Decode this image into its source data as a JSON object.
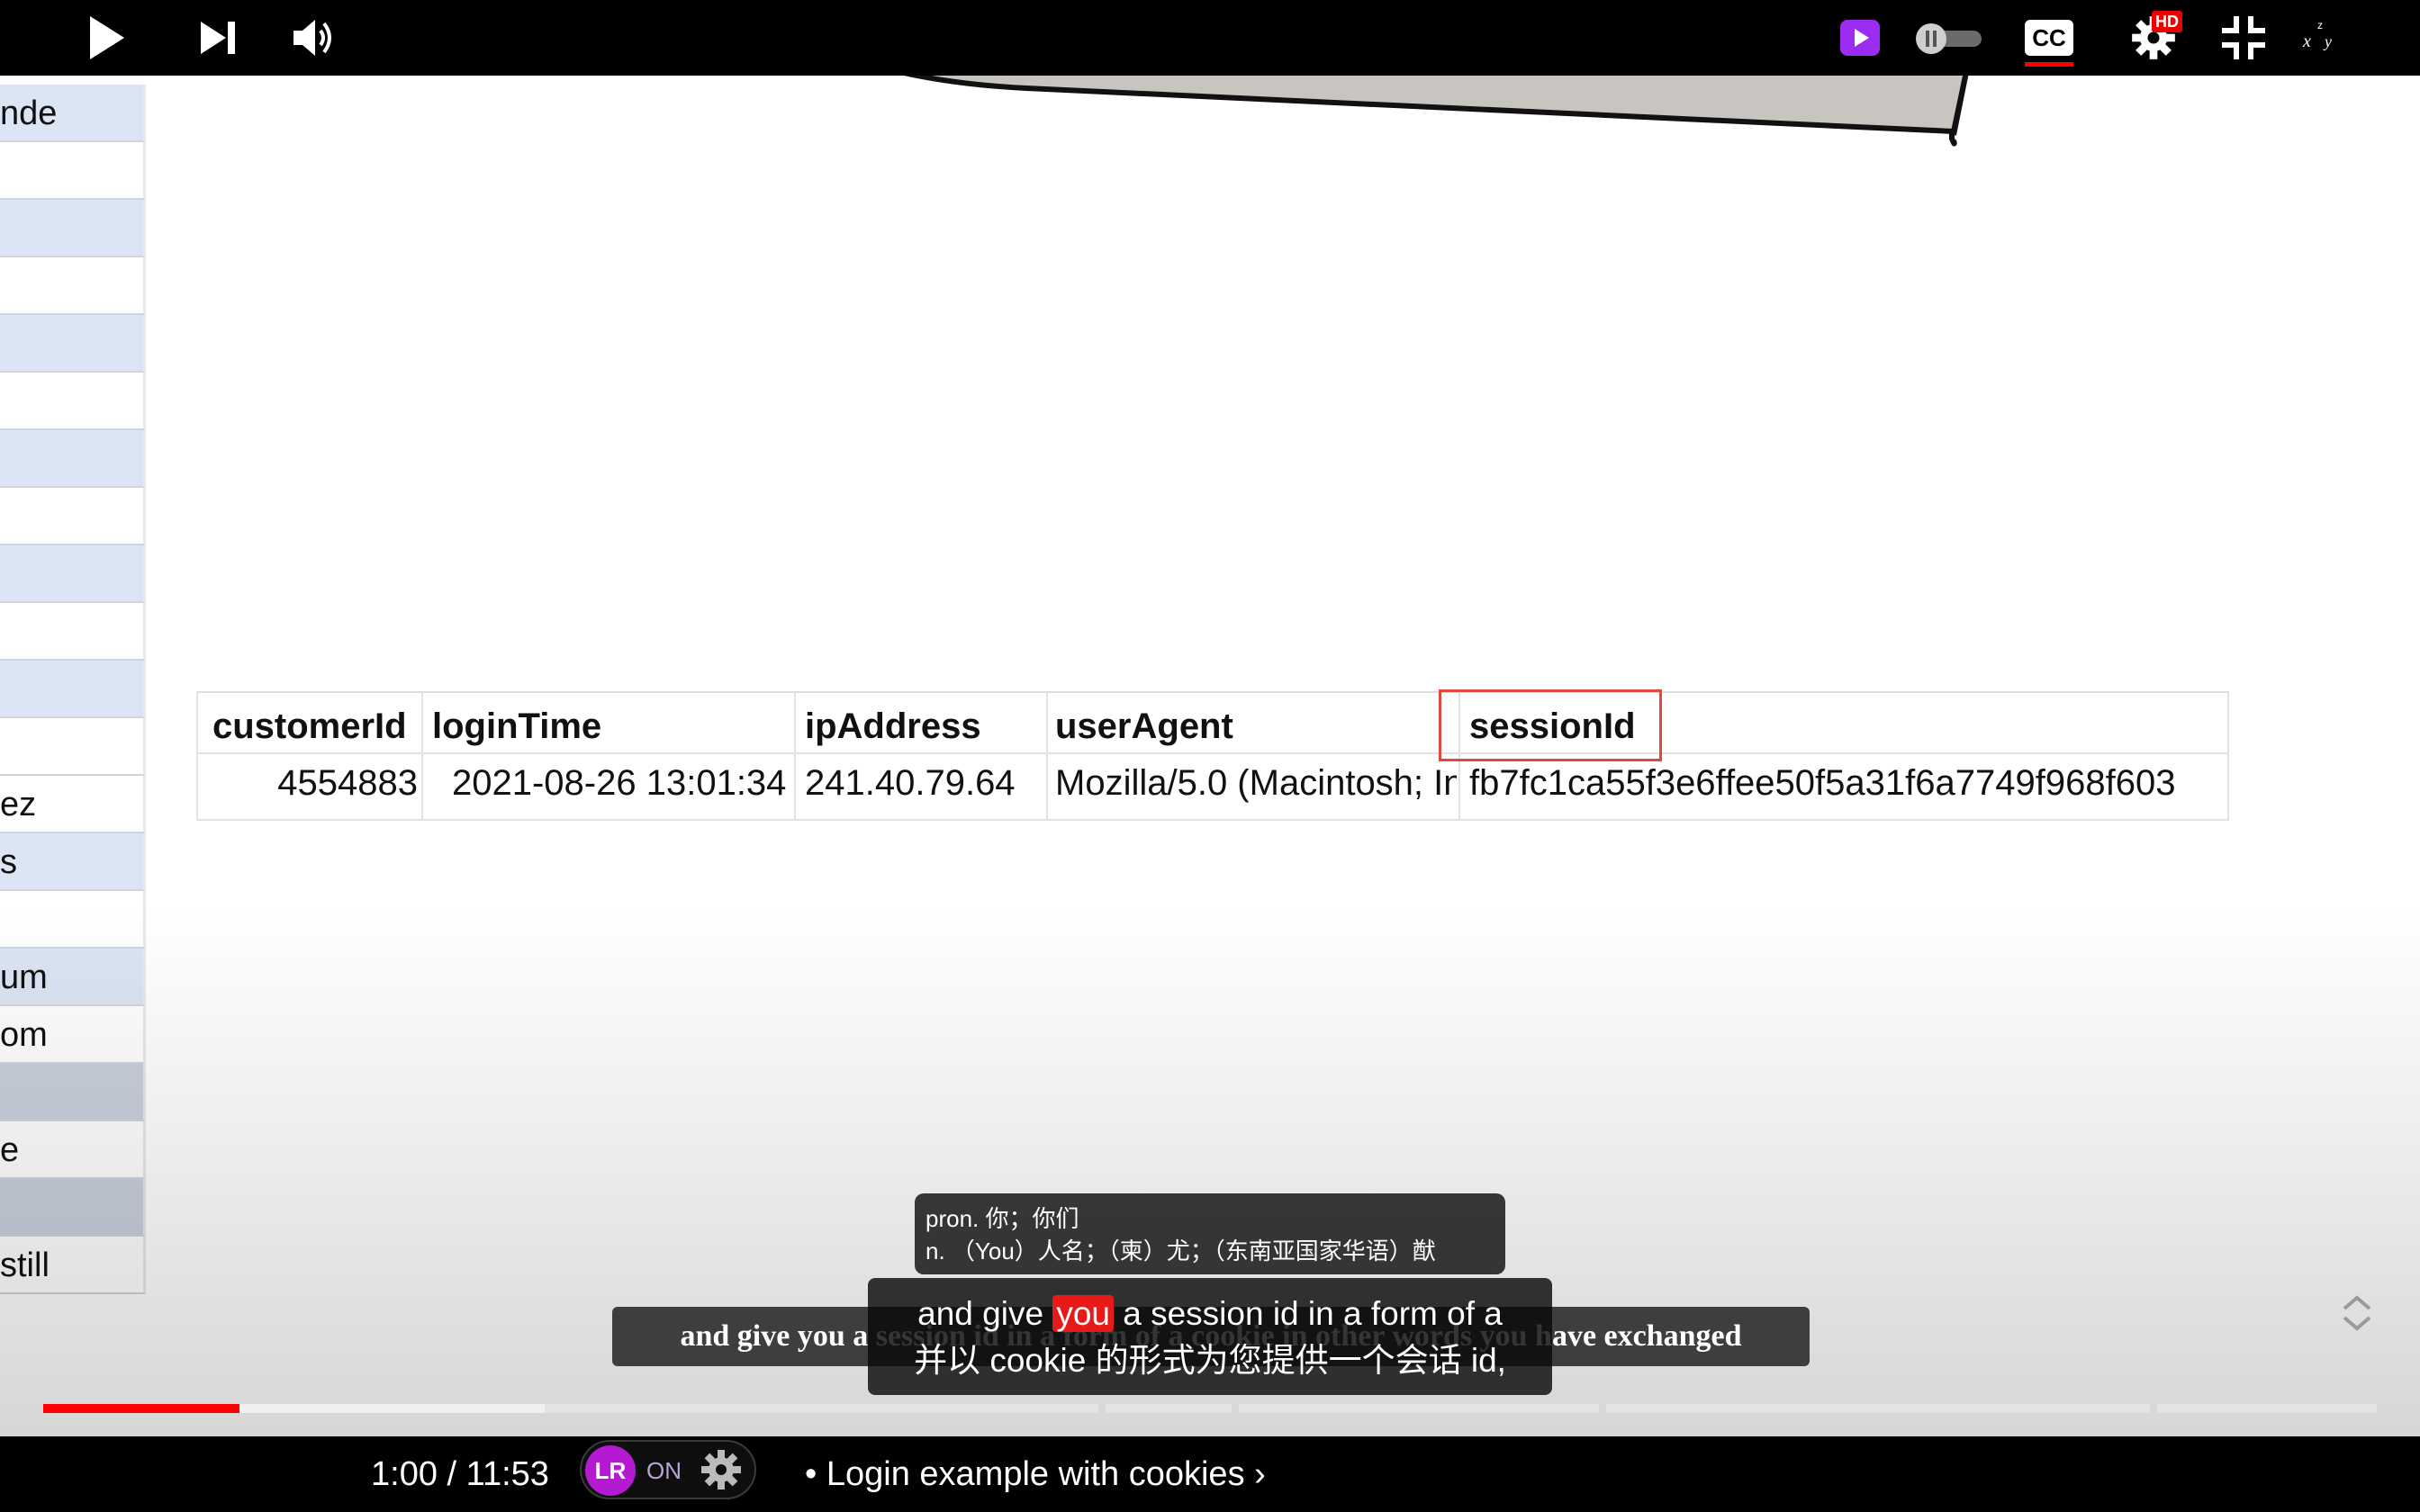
{
  "left_sheet": {
    "rows": [
      "nde",
      "",
      "",
      "",
      "",
      "",
      "",
      "",
      "",
      "",
      "",
      "",
      "ez",
      "s",
      "",
      "um",
      "om",
      "",
      "e",
      "",
      "still"
    ]
  },
  "table": {
    "headers": [
      "customerId",
      "loginTime",
      "ipAddress",
      "userAgent",
      "sessionId"
    ],
    "row": [
      "4554883",
      "2021-08-26 13:01:34",
      "241.40.79.64",
      "Mozilla/5.0 (Macintosh; In",
      "fb7fc1ca55f3e6ffee50f5a31f6a7749f968f603"
    ]
  },
  "dictionary_popup": {
    "line1": "pron. 你；你们",
    "line2": "n. （You）人名；（柬）尤；（东南亚国家华语）猷"
  },
  "captions": {
    "original": "and give you a session id in a form of a cookie in other words you have exchanged",
    "dual_before": "and give ",
    "dual_highlight": "you",
    "dual_after": " a session id in a form of a",
    "dual_translation": "并以 cookie 的形式为您提供一个会话 id,"
  },
  "player": {
    "time": "1:00 / 11:53",
    "lr_logo": "LR",
    "lr_status": "ON",
    "chapter": "• Login example with cookies ›",
    "hd_badge": "HD",
    "cc_label": "CC",
    "progress_fraction": 0.084,
    "buffered_fraction": 0.215
  },
  "icons": {
    "play": "play-icon",
    "next": "next-icon",
    "volume": "volume-icon",
    "settings": "gear-icon",
    "miniplayer": "miniplayer-icon",
    "autoplay": "autoplay-toggle",
    "fullscreen_exit": "exit-fullscreen-icon"
  },
  "colors": {
    "progress": "#ff0000",
    "highlight": "#e81919",
    "lr_brand": "#b51ad3",
    "session_box": "#e04a3c"
  }
}
